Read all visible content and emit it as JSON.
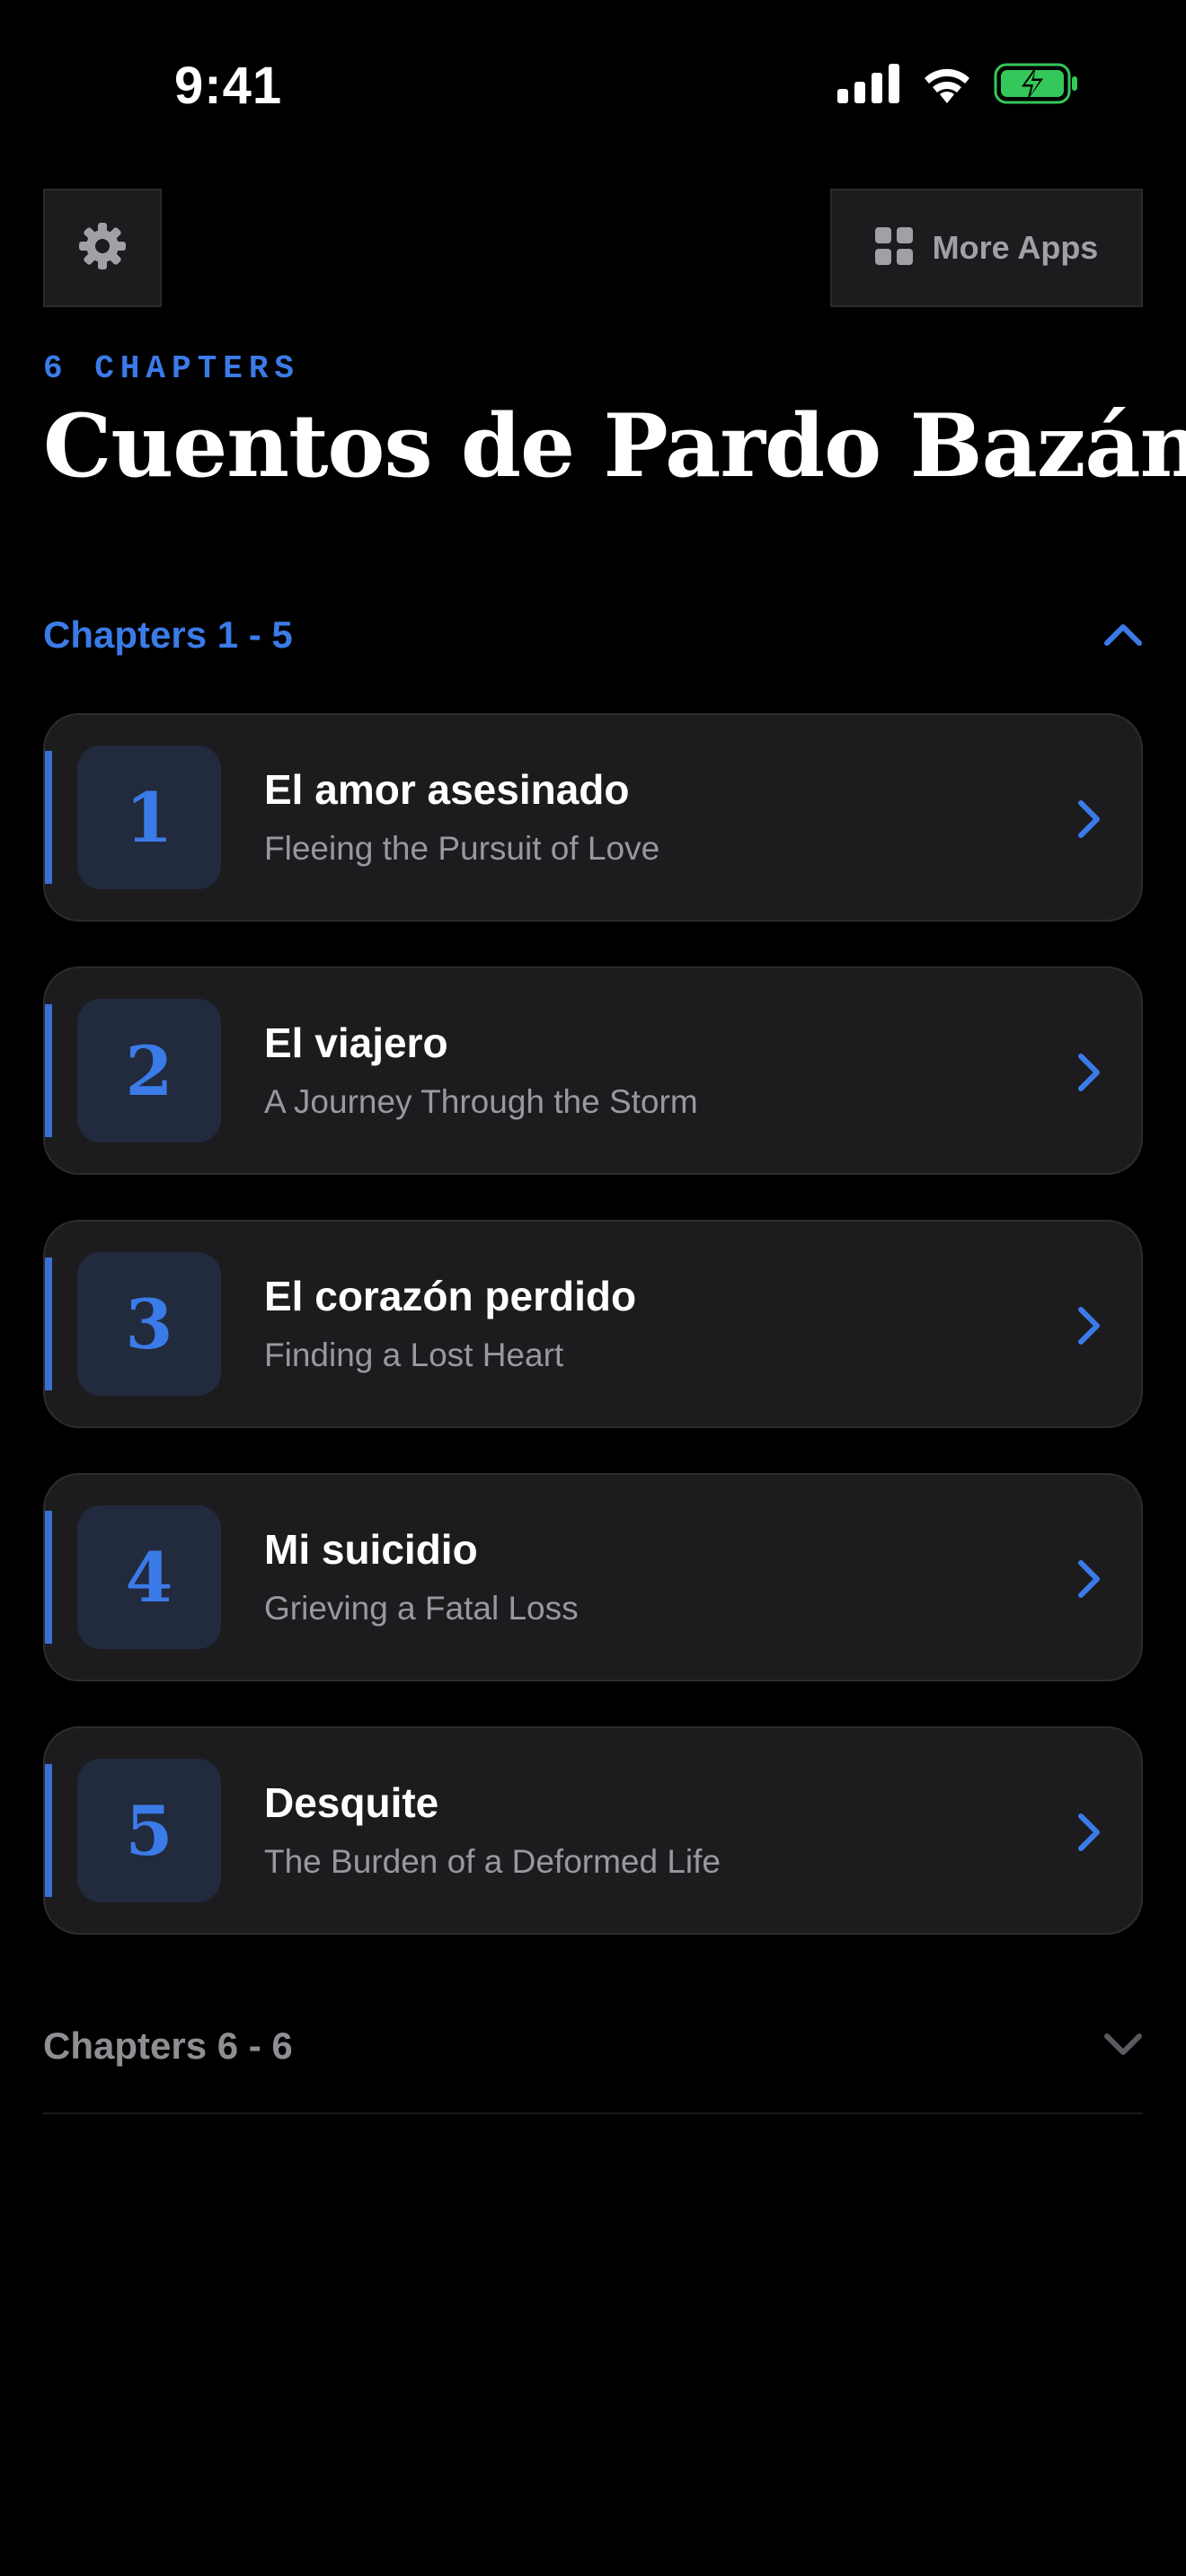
{
  "status_bar": {
    "time": "9:41"
  },
  "toolbar": {
    "settings_icon": "gear-icon",
    "more_apps_label": "More Apps",
    "more_apps_icon": "grid-icon"
  },
  "header": {
    "eyebrow": "6 CHAPTERS",
    "title": "Cuentos de Pardo Bazán"
  },
  "sections": [
    {
      "label": "Chapters 1 - 5",
      "expanded": true,
      "chapters": [
        {
          "number": "1",
          "title": "El amor asesinado",
          "subtitle": "Fleeing the Pursuit of Love"
        },
        {
          "number": "2",
          "title": "El viajero",
          "subtitle": "A Journey Through the Storm"
        },
        {
          "number": "3",
          "title": "El corazón perdido",
          "subtitle": "Finding a Lost Heart"
        },
        {
          "number": "4",
          "title": "Mi suicidio",
          "subtitle": "Grieving a Fatal Loss"
        },
        {
          "number": "5",
          "title": "Desquite",
          "subtitle": "The Burden of a Deformed Life"
        }
      ]
    },
    {
      "label": "Chapters 6 - 6",
      "expanded": false
    }
  ],
  "colors": {
    "accent": "#3b7be8",
    "background": "#000000",
    "card": "#1c1c1e",
    "battery": "#34c759"
  }
}
